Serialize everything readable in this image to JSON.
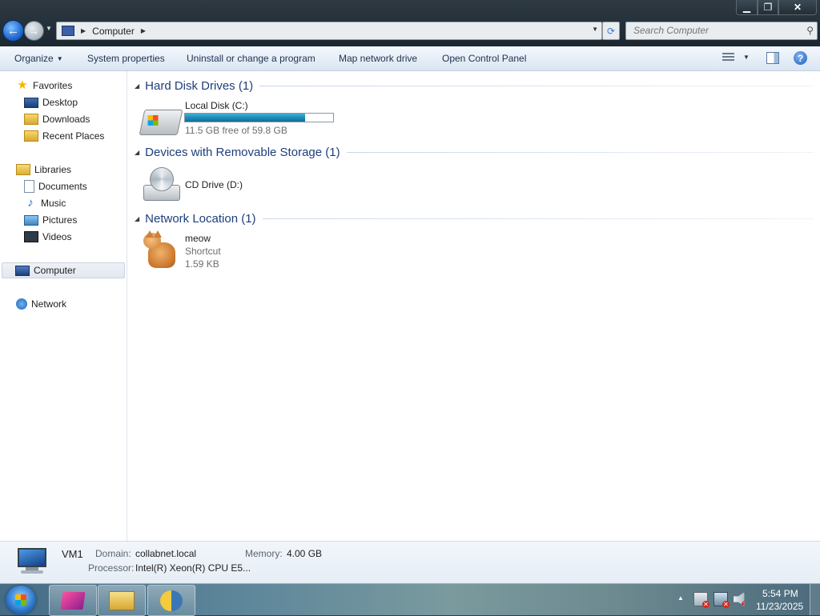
{
  "addressbar": {
    "location": "Computer"
  },
  "search": {
    "placeholder": "Search Computer"
  },
  "toolbar": {
    "organize": "Organize",
    "system_properties": "System properties",
    "uninstall": "Uninstall or change a program",
    "map_drive": "Map network drive",
    "control_panel": "Open Control Panel"
  },
  "sidebar": {
    "favorites": "Favorites",
    "desktop": "Desktop",
    "downloads": "Downloads",
    "recent_places": "Recent Places",
    "libraries": "Libraries",
    "documents": "Documents",
    "music": "Music",
    "pictures": "Pictures",
    "videos": "Videos",
    "computer": "Computer",
    "network": "Network"
  },
  "groups": {
    "hard_disk": "Hard Disk Drives (1)",
    "removable": "Devices with Removable Storage (1)",
    "network_location": "Network Location (1)"
  },
  "items": {
    "local_disk": {
      "name": "Local Disk (C:)",
      "free_text": "11.5 GB free of 59.8 GB",
      "used_fraction": 0.81
    },
    "cd_drive": {
      "name": "CD Drive (D:)"
    },
    "meow": {
      "name": "meow",
      "type": "Shortcut",
      "size": "1.59 KB"
    }
  },
  "details": {
    "name": "VM1",
    "domain_label": "Domain:",
    "domain_value": "collabnet.local",
    "memory_label": "Memory:",
    "memory_value": "4.00 GB",
    "processor_label": "Processor:",
    "processor_value": "Intel(R) Xeon(R) CPU E5..."
  },
  "taskbar": {
    "time": "5:54 PM",
    "date": "11/23/2025"
  },
  "colors": {
    "group_title": "#1e3e7a",
    "progress_fill": "#1d8db8"
  }
}
